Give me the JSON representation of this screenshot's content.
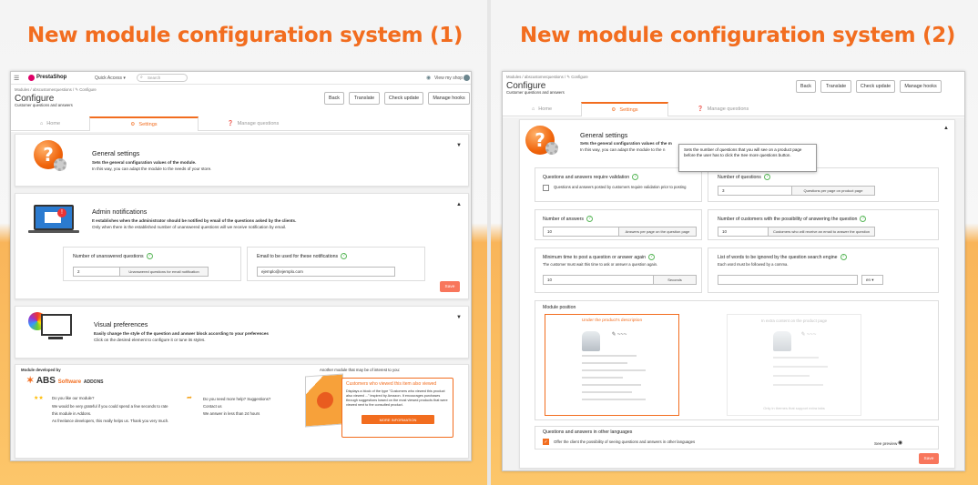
{
  "left": {
    "heading": "New module configuration system (1)",
    "topbar": {
      "brand": "PrestaShop",
      "quick_access": "Quick Access ▾",
      "search_placeholder": "Search",
      "view_shop": "View my shop"
    },
    "breadcrumb": "Modules  /  abscustomerquestions  /  ✎ Configure",
    "page_title": "Configure",
    "page_subtitle": "Customer questions and answers",
    "toolbar": [
      "Back",
      "Translate",
      "Check update",
      "Manage hooks"
    ],
    "tabs": [
      "Home",
      "Settings",
      "Manage questions"
    ],
    "general": {
      "title": "General settings",
      "desc_bold": "Sets the general configuration values of the module.",
      "desc": "In this way, you can adapt the module to the needs of your store."
    },
    "admin": {
      "title": "Admin notifications",
      "desc_bold": "It establishes when the administrator should be notified by email of the questions asked by the clients.",
      "desc": "Only when there is the established number of unanswered questions will we receive notification by email.",
      "unanswered_label": "Number of unanswered questions",
      "unanswered_value": "2",
      "unanswered_addon": "Unanswered questions for email notification",
      "email_label": "Email to be used for these notifications",
      "email_value": "ejemplo@ejemplo.com",
      "save": "Save"
    },
    "visual": {
      "title": "Visual preferences",
      "desc_bold": "Easily change the style of the question and answer block according to your preferences",
      "desc": "Click on the desired element to configure it or tune its styles."
    },
    "footer": {
      "developed_by": "Module developed by",
      "abs_brand": "ABS",
      "abs_software": "Software",
      "abs_addons": "ADDONS",
      "like_q": "Do you like our module?",
      "like_body1": "We would be very grateful if you could spend a few seconds to rate",
      "like_body2": "this module in Addons.",
      "like_body3": "As freelance developers, this really helps us. Thank you very much.",
      "help_q": "Do you need more help? Suggestions?",
      "contact": "Contact us",
      "answer_time": "We answer in less than 24 hours",
      "another": "Another module that may be of interest to you:",
      "promo_title": "Customers who viewed this item also viewed",
      "promo_body": "Displays a block of the type \"Customers who viewed this product also viewed ...\" inspired by Amazon. It encourages purchases through suggestions based on the most viewed products that were viewed next to the consulted product.",
      "more_info": "MORE INFORMATION"
    }
  },
  "right": {
    "heading": "New module configuration system (2)",
    "breadcrumb": "Modules  /  abscustomerquestions  /  ✎ Configure",
    "page_title": "Configure",
    "page_subtitle": "Customer questions and answers",
    "toolbar": [
      "Back",
      "Translate",
      "Check update",
      "Manage hooks"
    ],
    "tabs": [
      "Home",
      "Settings",
      "Manage questions"
    ],
    "general": {
      "title": "General settings",
      "desc_bold": "Sets the general configuration values of the m",
      "desc": "In this way, you can adapt the module to the n"
    },
    "tooltip": "Sets the number of questions that you will see on a product page before the user has to click the See more questions button.",
    "require_validation": {
      "label": "Questions and answers require validation",
      "check_text": "Questions and answers posted by customers require validation prior to posting"
    },
    "num_questions": {
      "label": "Number of questions",
      "value": "3",
      "addon": "Questions per page on product page"
    },
    "num_answers": {
      "label": "Number of answers",
      "value": "10",
      "addon": "Answers per page on the question page"
    },
    "num_customers": {
      "label": "Number of customers with the possibility of answering the question",
      "value": "10",
      "addon": "Customers who will receive an email to answer the question"
    },
    "min_time": {
      "label": "Minimum time to post a question or answer again",
      "desc": "The customer must wait this time to ask or answer a question again.",
      "value": "10",
      "addon": "Seconds"
    },
    "ignore_words": {
      "label": "List of words to be ignored by the question search engine",
      "desc": "Each word must be followed by a comma.",
      "lang": "en ▾"
    },
    "module_position": {
      "label": "Module position",
      "option1": "Under the product's description",
      "option2": "In extra content on the product page",
      "option2_sub": "Only in themes that support extra tabs"
    },
    "other_languages": {
      "label": "Questions and answers in other languages",
      "check_text": "Offer the client the possibility of seeing questions and answers in other languages",
      "see_preview": "See preview"
    },
    "save": "Save"
  },
  "colors": {
    "accent": "#f26d1f",
    "save": "#f8765c",
    "help": "#5cb85c"
  }
}
